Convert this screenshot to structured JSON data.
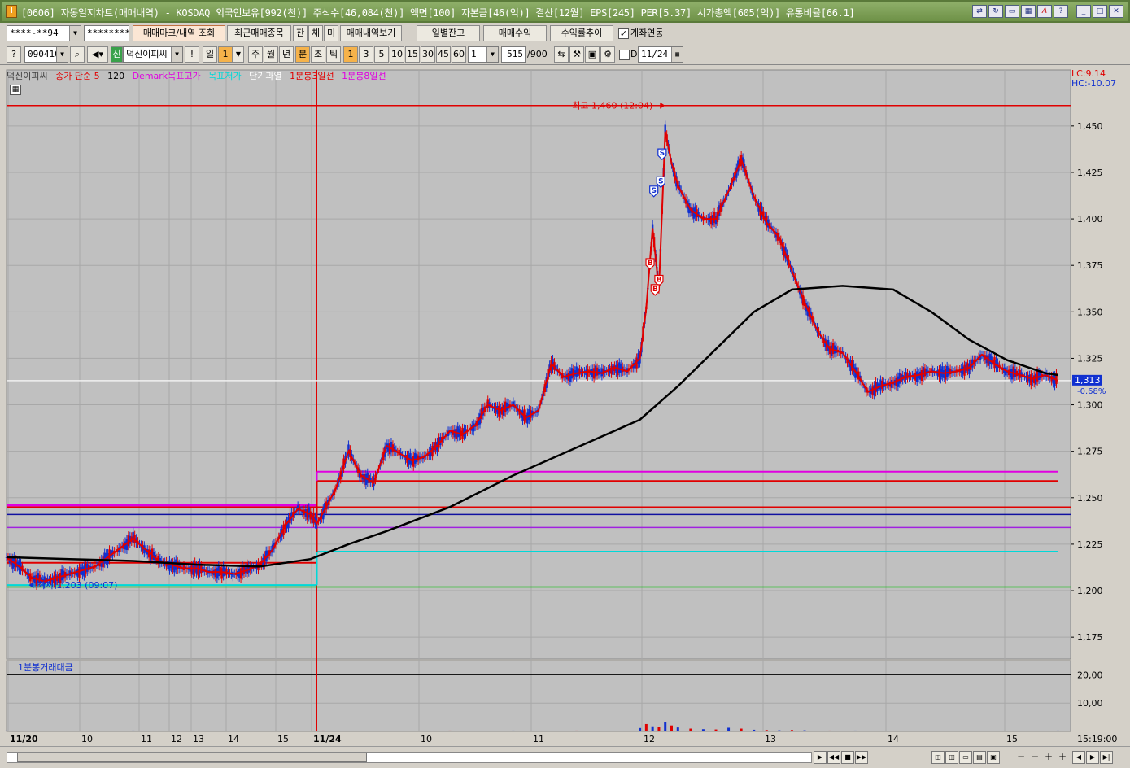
{
  "window": {
    "title": "[0606] 자동일지차트(매매내역) - KOSDAQ 외국인보유[992(천)] 주식수[46,084(천)] 액면[100] 자본금[46(억)] 결산[12월] EPS[245] PER[5.37] 시가총액[605(억)] 유통비율[66.1]",
    "app_icon": "I"
  },
  "row1": {
    "account": "****-**94",
    "password": "*********",
    "mark_query_label": "매매마크/내역 조회",
    "recent_trades_label": "최근매매종목",
    "btn_jan": "잔",
    "btn_che": "체",
    "btn_mi": "미",
    "trade_view_label": "매매내역보기",
    "daily_balance_label": "일별잔고",
    "trade_profit_label": "매매수익",
    "return_trend_label": "수익률추이",
    "account_link_label": "계좌연동",
    "account_link_checked": "✓"
  },
  "row2": {
    "code": "090410",
    "new_badge": "신",
    "stock_name": "덕신이피씨",
    "exclaim": "!",
    "period_day": "일",
    "period_num": "1",
    "week": "주",
    "month": "월",
    "year": "년",
    "minute": "분",
    "second": "초",
    "tick": "틱",
    "intervals": [
      "1",
      "3",
      "5",
      "10",
      "15",
      "30",
      "45",
      "60"
    ],
    "count": "1",
    "range_value": "515",
    "range_total": "/900",
    "d_label": "D",
    "date": "11/24"
  },
  "legend": {
    "name": "덕신이피씨",
    "ma5": "종가 단순 5",
    "ma120": "120",
    "demark_target": "Demark목표고가",
    "target_low": "목표저가",
    "short_overheat": "단기과열",
    "b3": "1분봉3일선",
    "b8": "1분봉8일선",
    "lc": "LC:9.14",
    "hc": "HC:-10.07"
  },
  "annotations": {
    "high": "최고 1,460 (12:04)",
    "low": "최저 1,203 (09:07)",
    "current_price": "1,313",
    "current_change": "-0.68%",
    "volume_pane_title": "1분봉거래대금",
    "buy_mark": "B",
    "sell_mark": "S"
  },
  "colors": {
    "ma5": "#e00000",
    "ma120": "#000000",
    "demark": "#e000e0",
    "target_low": "#00d8d8",
    "b3": "#e00000",
    "b8": "#e000e0",
    "up": "#e00000",
    "down": "#1030d0"
  },
  "chart_data": {
    "type": "line",
    "title": "",
    "price_axis": {
      "ticks": [
        "1,450",
        "1,425",
        "1,400",
        "1,375",
        "1,350",
        "1,325",
        "1,300",
        "1,275",
        "1,250",
        "1,225",
        "1,200",
        "1,175"
      ],
      "ylim": [
        1165,
        1467
      ]
    },
    "volume_axis": {
      "ticks": [
        "20,00",
        "10,00"
      ]
    },
    "x_ticks": [
      "11/20",
      "10",
      "11",
      "12",
      "13",
      "14",
      "15",
      "11/24",
      "10",
      "11",
      "12",
      "13",
      "14",
      "15"
    ],
    "x_end_label": "15:19:00",
    "close_series": [
      [
        0,
        1218
      ],
      [
        2,
        1213
      ],
      [
        4,
        1207
      ],
      [
        6,
        1205
      ],
      [
        8,
        1207
      ],
      [
        10,
        1209
      ],
      [
        12,
        1211
      ],
      [
        14,
        1213
      ],
      [
        16,
        1218
      ],
      [
        18,
        1223
      ],
      [
        20,
        1228
      ],
      [
        22,
        1222
      ],
      [
        24,
        1216
      ],
      [
        26,
        1214
      ],
      [
        28,
        1212
      ],
      [
        30,
        1212
      ],
      [
        32,
        1210
      ],
      [
        34,
        1210
      ],
      [
        36,
        1209
      ],
      [
        38,
        1211
      ],
      [
        40,
        1214
      ],
      [
        42,
        1222
      ],
      [
        44,
        1235
      ],
      [
        46,
        1244
      ],
      [
        48,
        1241
      ],
      [
        49,
        1236
      ],
      [
        50,
        1242
      ],
      [
        52,
        1255
      ],
      [
        54,
        1275
      ],
      [
        56,
        1262
      ],
      [
        58,
        1258
      ],
      [
        60,
        1278
      ],
      [
        62,
        1274
      ],
      [
        64,
        1270
      ],
      [
        66,
        1272
      ],
      [
        68,
        1278
      ],
      [
        70,
        1286
      ],
      [
        72,
        1284
      ],
      [
        74,
        1289
      ],
      [
        76,
        1300
      ],
      [
        78,
        1297
      ],
      [
        80,
        1300
      ],
      [
        82,
        1293
      ],
      [
        84,
        1297
      ],
      [
        86,
        1322
      ],
      [
        88,
        1315
      ],
      [
        90,
        1317
      ],
      [
        92,
        1318
      ],
      [
        94,
        1317
      ],
      [
        96,
        1320
      ],
      [
        98,
        1318
      ],
      [
        100,
        1325
      ],
      [
        101,
        1352
      ],
      [
        102,
        1395
      ],
      [
        103,
        1362
      ],
      [
        104,
        1447
      ],
      [
        105,
        1430
      ],
      [
        106,
        1418
      ],
      [
        108,
        1405
      ],
      [
        110,
        1400
      ],
      [
        112,
        1400
      ],
      [
        114,
        1415
      ],
      [
        116,
        1432
      ],
      [
        118,
        1412
      ],
      [
        120,
        1398
      ],
      [
        122,
        1390
      ],
      [
        124,
        1372
      ],
      [
        126,
        1355
      ],
      [
        128,
        1340
      ],
      [
        130,
        1330
      ],
      [
        132,
        1328
      ],
      [
        134,
        1318
      ],
      [
        136,
        1307
      ],
      [
        138,
        1310
      ],
      [
        140,
        1312
      ],
      [
        142,
        1315
      ],
      [
        144,
        1316
      ],
      [
        146,
        1318
      ],
      [
        148,
        1317
      ],
      [
        150,
        1318
      ],
      [
        152,
        1320
      ],
      [
        154,
        1327
      ],
      [
        156,
        1322
      ],
      [
        158,
        1318
      ],
      [
        160,
        1316
      ],
      [
        162,
        1314
      ],
      [
        164,
        1316
      ],
      [
        166,
        1313
      ]
    ],
    "ma120_series": [
      [
        0,
        1218
      ],
      [
        10,
        1217
      ],
      [
        20,
        1216
      ],
      [
        30,
        1214
      ],
      [
        40,
        1213
      ],
      [
        48,
        1217
      ],
      [
        54,
        1225
      ],
      [
        60,
        1232
      ],
      [
        70,
        1245
      ],
      [
        80,
        1262
      ],
      [
        90,
        1277
      ],
      [
        100,
        1292
      ],
      [
        106,
        1310
      ],
      [
        112,
        1330
      ],
      [
        118,
        1350
      ],
      [
        124,
        1362
      ],
      [
        132,
        1364
      ],
      [
        140,
        1362
      ],
      [
        146,
        1350
      ],
      [
        152,
        1335
      ],
      [
        158,
        1324
      ],
      [
        164,
        1317
      ],
      [
        166,
        1316
      ]
    ],
    "hlines": [
      {
        "name": "demark-left",
        "y": 1246,
        "x": [
          0,
          49
        ]
      },
      {
        "name": "red-left",
        "y": 1215,
        "x": [
          0,
          49
        ]
      },
      {
        "name": "cyan-left",
        "y": 1203,
        "x": [
          0,
          49
        ]
      },
      {
        "name": "demark-right",
        "y": 1264,
        "x": [
          49,
          166
        ]
      },
      {
        "name": "red-right",
        "y": 1259,
        "x": [
          49,
          166
        ]
      },
      {
        "name": "cyan-right",
        "y": 1221,
        "x": [
          49,
          166
        ]
      },
      {
        "name": "red-full",
        "y": 1245,
        "x": [
          0,
          168
        ]
      },
      {
        "name": "navy-full",
        "y": 1241,
        "x": [
          0,
          168
        ]
      },
      {
        "name": "violet-full",
        "y": 1234,
        "x": [
          0,
          168
        ]
      },
      {
        "name": "green-full",
        "y": 1202,
        "x": [
          0,
          168
        ]
      },
      {
        "name": "high-line",
        "y": 1461,
        "x": [
          0,
          168
        ]
      },
      {
        "name": "gray-current",
        "y": 1313,
        "x": [
          0,
          168
        ]
      }
    ],
    "trade_marks": [
      {
        "type": "S",
        "x": 103.5,
        "y": 1435
      },
      {
        "type": "S",
        "x": 103.3,
        "y": 1420
      },
      {
        "type": "S",
        "x": 102.2,
        "y": 1415
      },
      {
        "type": "B",
        "x": 101.6,
        "y": 1376
      },
      {
        "type": "B",
        "x": 103.0,
        "y": 1367
      },
      {
        "type": "B",
        "x": 102.4,
        "y": 1362
      }
    ],
    "volume_bars": [
      [
        0,
        0.3
      ],
      [
        10,
        0.2
      ],
      [
        20,
        0.3
      ],
      [
        30,
        0.2
      ],
      [
        40,
        0.2
      ],
      [
        50,
        0.3
      ],
      [
        60,
        0.2
      ],
      [
        70,
        0.3
      ],
      [
        80,
        0.3
      ],
      [
        90,
        0.3
      ],
      [
        100,
        1.2
      ],
      [
        101,
        2.6
      ],
      [
        102,
        1.8
      ],
      [
        103,
        1.5
      ],
      [
        104,
        3.3
      ],
      [
        105,
        2.1
      ],
      [
        106,
        1.4
      ],
      [
        108,
        1.0
      ],
      [
        110,
        0.8
      ],
      [
        112,
        0.7
      ],
      [
        114,
        1.3
      ],
      [
        116,
        1.0
      ],
      [
        118,
        0.6
      ],
      [
        120,
        0.5
      ],
      [
        122,
        0.4
      ],
      [
        124,
        0.5
      ],
      [
        126,
        0.4
      ],
      [
        130,
        0.3
      ],
      [
        134,
        0.3
      ],
      [
        140,
        0.2
      ],
      [
        150,
        0.2
      ],
      [
        160,
        0.2
      ],
      [
        166,
        0.3
      ]
    ],
    "volume_ylim": [
      0,
      23
    ]
  }
}
